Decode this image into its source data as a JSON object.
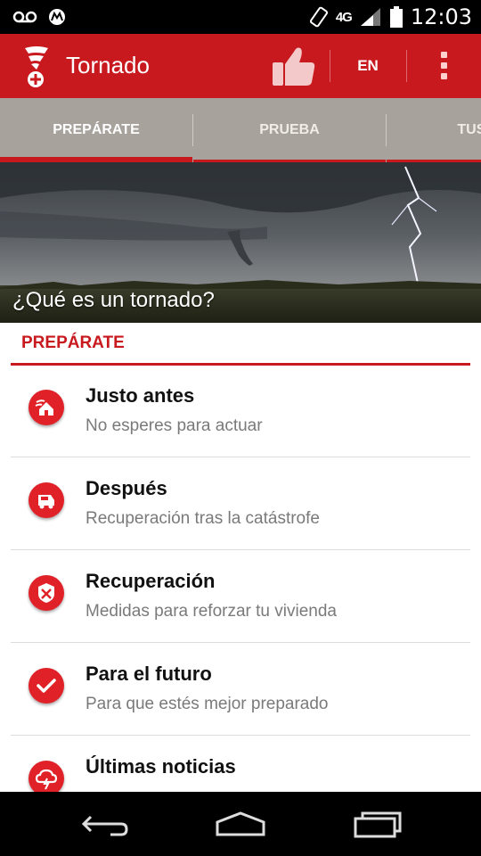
{
  "status_bar": {
    "left_icons": [
      "voicemail-icon",
      "motorola-icon"
    ],
    "network": "4G",
    "time": "12:03"
  },
  "app_bar": {
    "title": "Tornado",
    "lang_label": "EN",
    "color": "#c8191f"
  },
  "tabs": [
    {
      "label": "PREPÁRATE",
      "active": true
    },
    {
      "label": "PRUEBA",
      "active": false
    },
    {
      "label": "TUS AL",
      "active": false
    }
  ],
  "hero": {
    "caption": "¿Qué es un tornado?"
  },
  "section": {
    "title": "PREPÁRATE"
  },
  "items": [
    {
      "title": "Justo antes",
      "subtitle": "No esperes para actuar",
      "icon": "house-wind-icon"
    },
    {
      "title": "Después",
      "subtitle": "Recuperación tras la catástrofe",
      "icon": "truck-icon"
    },
    {
      "title": "Recuperación",
      "subtitle": "Medidas para reforzar tu vivienda",
      "icon": "shield-icon"
    },
    {
      "title": "Para el futuro",
      "subtitle": "Para que estés mejor preparado",
      "icon": "checkmark-icon"
    },
    {
      "title": "Últimas noticias",
      "subtitle": "",
      "icon": "storm-cloud-icon"
    }
  ],
  "nav_bar": {
    "buttons": [
      "back-icon",
      "home-icon",
      "recent-apps-icon"
    ]
  }
}
